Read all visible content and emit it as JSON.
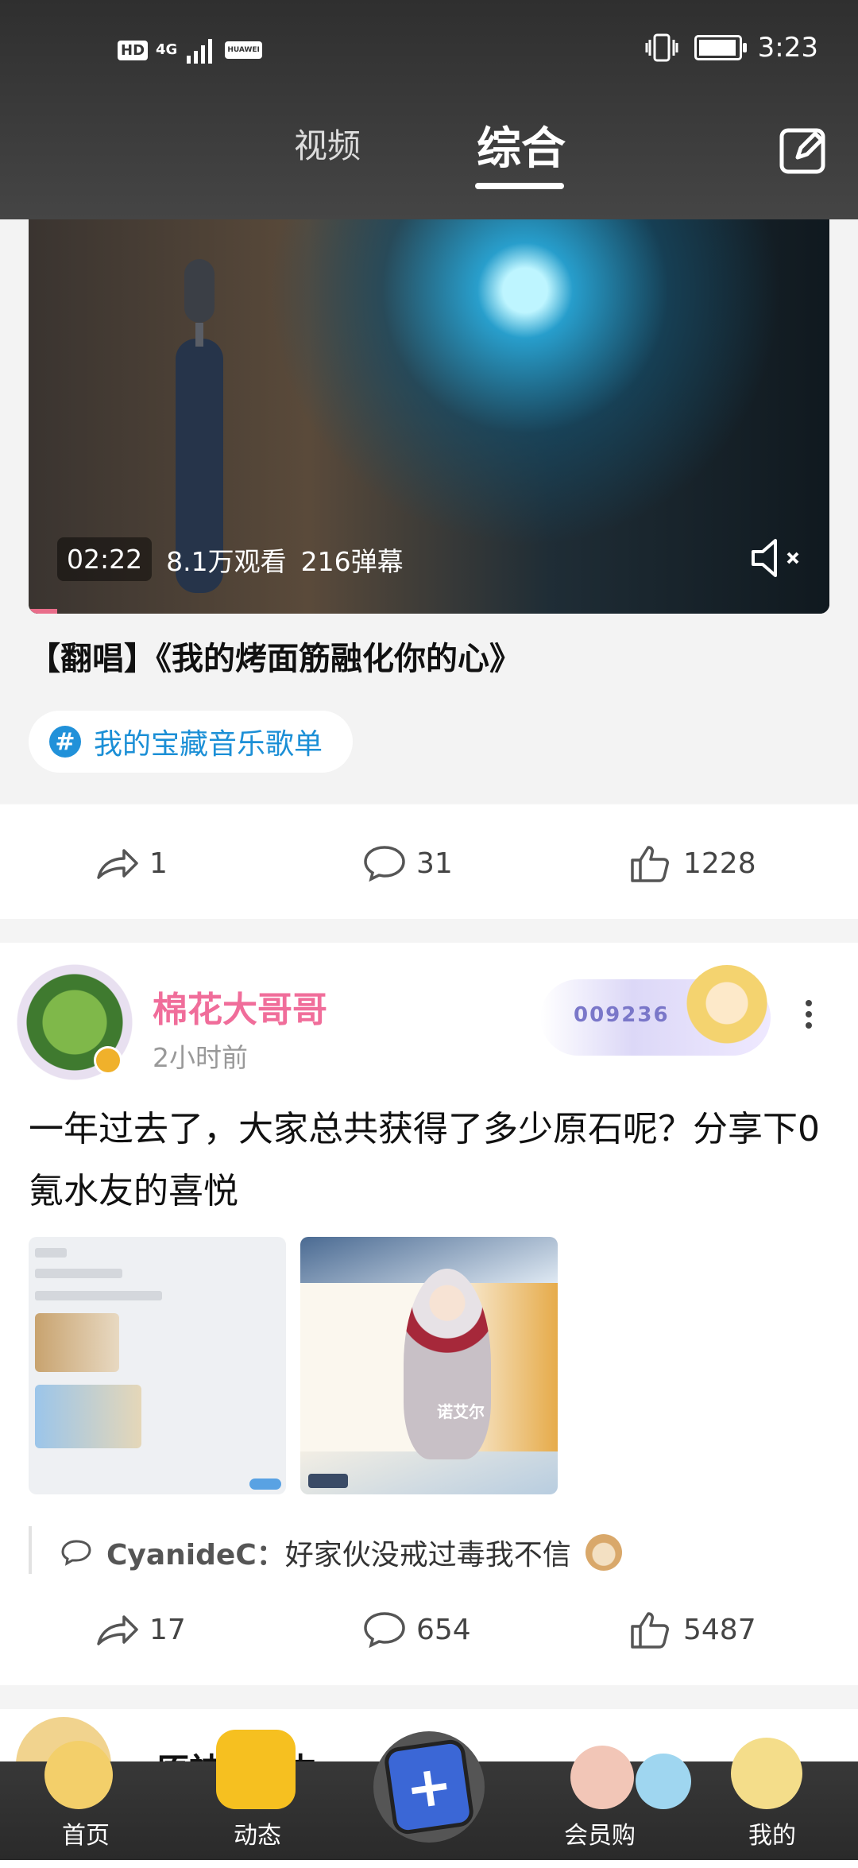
{
  "status_bar": {
    "hd": "HD",
    "network": "4G",
    "carrier_badge": "HUAWEI",
    "time": "3:23"
  },
  "top_tabs": [
    {
      "label": "视频",
      "active": false
    },
    {
      "label": "综合",
      "active": true
    }
  ],
  "icons": {
    "edit": "edit-icon",
    "mute": "mute-icon",
    "share": "share-icon",
    "comment": "comment-icon",
    "like": "like-icon",
    "more": "more-vertical-icon"
  },
  "video_card": {
    "duration": "02:22",
    "views": "8.1万观看",
    "danmaku": "216弹幕",
    "title": "【翻唱】《我的烤面筋融化你的心》",
    "topic": "我的宝藏音乐歌单",
    "share_count": "1",
    "comment_count": "31",
    "like_count": "1228"
  },
  "post_card": {
    "username": "棉花大哥哥",
    "time": "2小时前",
    "fan_badge_number": "009236",
    "text": "一年过去了，大家总共获得了多少原石呢？分享下0氪水友的喜悦",
    "image2_caption": "诺艾尔",
    "comment_user": "CyanideC：",
    "comment_text": "好家伙没戒过毒我不信",
    "share_count": "17",
    "comment_count": "654",
    "like_count": "5487"
  },
  "next_card": {
    "title_partial": "原神 ... 生"
  },
  "bottom_nav": [
    {
      "label": "首页"
    },
    {
      "label": "动态"
    },
    {
      "label": "+"
    },
    {
      "label": "会员购"
    },
    {
      "label": "我的"
    }
  ],
  "colors": {
    "header_bg": "#3a3a3a",
    "username_pink": "#f06d9a",
    "topic_blue": "#1b8fd6",
    "publish_blue": "#3b67d6"
  }
}
